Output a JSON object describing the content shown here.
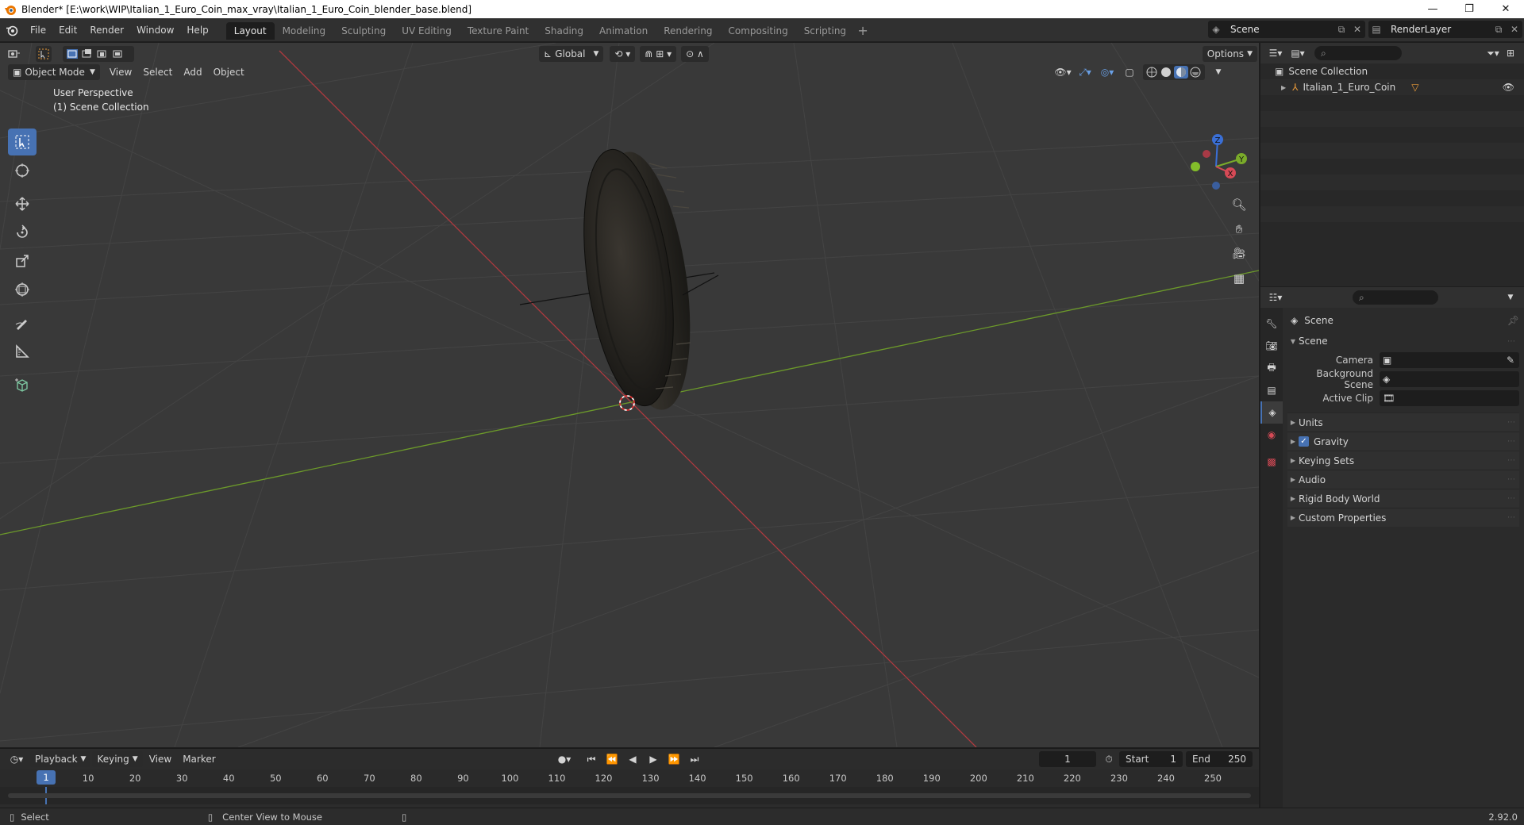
{
  "window": {
    "title": "Blender* [E:\\work\\WIP\\Italian_1_Euro_Coin_max_vray\\Italian_1_Euro_Coin_blender_base.blend]",
    "minimize": "—",
    "maximize": "❐",
    "close": "✕"
  },
  "menu": [
    "File",
    "Edit",
    "Render",
    "Window",
    "Help"
  ],
  "workspaces": [
    "Layout",
    "Modeling",
    "Sculpting",
    "UV Editing",
    "Texture Paint",
    "Shading",
    "Animation",
    "Rendering",
    "Compositing",
    "Scripting"
  ],
  "active_workspace": "Layout",
  "scene_selector": {
    "value": "Scene"
  },
  "view_layer_selector": {
    "value": "RenderLayer"
  },
  "viewport": {
    "mode": "Object Mode",
    "menus": [
      "View",
      "Select",
      "Add",
      "Object"
    ],
    "transform_orientation": "Global",
    "options_label": "Options",
    "info_line1": "User Perspective",
    "info_line2": "(1) Scene Collection",
    "gizmo_axes": {
      "z": "Z",
      "y": "Y",
      "x": "X"
    },
    "colors": {
      "background": "#393939",
      "x_axis": "#b03a3f",
      "y_axis": "#6c9a2a",
      "accent": "#4772b3"
    }
  },
  "tools": [
    "select-box",
    "cursor",
    "move",
    "rotate",
    "scale",
    "transform",
    "annotate",
    "measure",
    "add-cube"
  ],
  "timeline": {
    "menus": [
      "Playback",
      "Keying",
      "View",
      "Marker"
    ],
    "current_frame": "1",
    "start_label": "Start",
    "start_value": "1",
    "end_label": "End",
    "end_value": "250",
    "ruler_ticks": [
      "1",
      "10",
      "20",
      "30",
      "40",
      "50",
      "60",
      "70",
      "80",
      "90",
      "100",
      "110",
      "120",
      "130",
      "140",
      "150",
      "160",
      "170",
      "180",
      "190",
      "200",
      "210",
      "220",
      "230",
      "240",
      "250"
    ]
  },
  "statusbar": {
    "left_hint": "Select",
    "middle_hint": "Center View to Mouse",
    "version": "2.92.0"
  },
  "outliner": {
    "root": "Scene Collection",
    "items": [
      {
        "name": "Italian_1_Euro_Coin"
      }
    ]
  },
  "properties": {
    "context": "Scene",
    "panel_title": "Scene",
    "fields": [
      {
        "label": "Camera",
        "value": ""
      },
      {
        "label": "Background Scene",
        "value": ""
      },
      {
        "label": "Active Clip",
        "value": ""
      }
    ],
    "panels": [
      "Units",
      "Gravity",
      "Keying Sets",
      "Audio",
      "Rigid Body World",
      "Custom Properties"
    ],
    "gravity_checked": true
  }
}
